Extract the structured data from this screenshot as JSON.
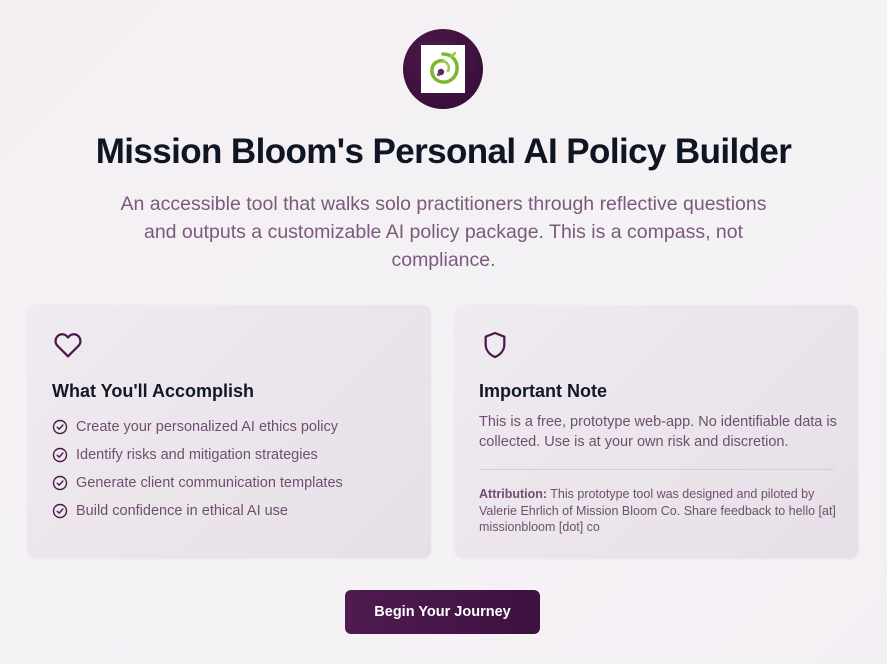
{
  "logo": {
    "icon": "mission-bloom-logo-icon"
  },
  "header": {
    "title": "Mission Bloom's Personal AI Policy Builder",
    "subtitle": "An accessible tool that walks solo practitioners through reflective questions and outputs a customizable AI policy package. This is a compass, not compliance."
  },
  "accomplish": {
    "icon": "heart-icon",
    "title": "What You'll Accomplish",
    "items": [
      {
        "label": "Create your personalized AI ethics policy"
      },
      {
        "label": "Identify risks and mitigation strategies"
      },
      {
        "label": "Generate client communication templates"
      },
      {
        "label": "Build confidence in ethical AI use"
      }
    ]
  },
  "note": {
    "icon": "shield-icon",
    "title": "Important Note",
    "text": "This is a free, prototype web-app. No identifiable data is collected. Use is at your own risk and discretion.",
    "attribution_label": "Attribution:",
    "attribution_text": " This prototype tool was designed and piloted by Valerie Ehrlich of Mission Bloom Co. Share feedback to hello [at] missionbloom [dot] co"
  },
  "cta": {
    "label": "Begin Your Journey"
  },
  "colors": {
    "brand_dark": "#3d1140",
    "accent_text": "#7a5a7c",
    "logo_green": "#7cb82f"
  }
}
